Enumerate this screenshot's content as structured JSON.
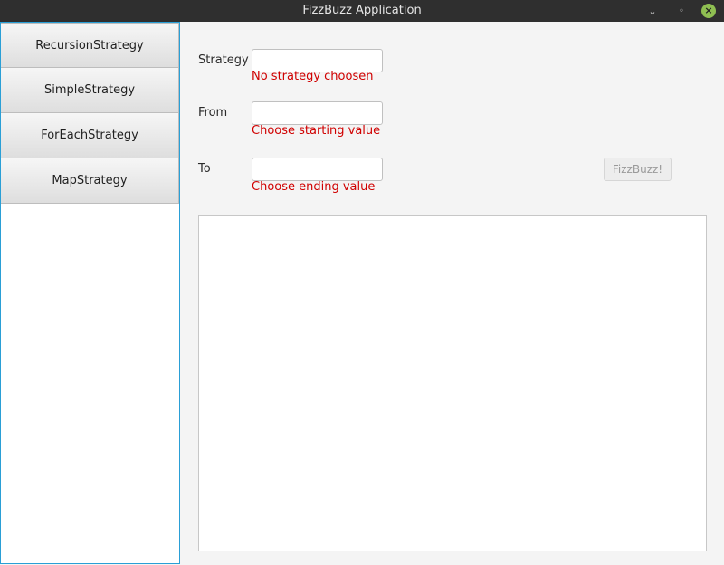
{
  "window": {
    "title": "FizzBuzz Application",
    "minimize_glyph": "⌄",
    "maximize_glyph": "◦",
    "close_glyph": "×"
  },
  "sidebar": {
    "items": [
      {
        "label": "RecursionStrategy"
      },
      {
        "label": "SimpleStrategy"
      },
      {
        "label": "ForEachStrategy"
      },
      {
        "label": "MapStrategy"
      }
    ]
  },
  "form": {
    "strategy": {
      "label": "Strategy",
      "value": "",
      "error": "No strategy choosen"
    },
    "from": {
      "label": "From",
      "value": "",
      "error": "Choose starting value"
    },
    "to": {
      "label": "To",
      "value": "",
      "error": "Choose ending value"
    },
    "submit_label": "FizzBuzz!"
  },
  "colors": {
    "error": "#d00000",
    "accent": "#2a9fd6",
    "close_button": "#8fbf52"
  }
}
